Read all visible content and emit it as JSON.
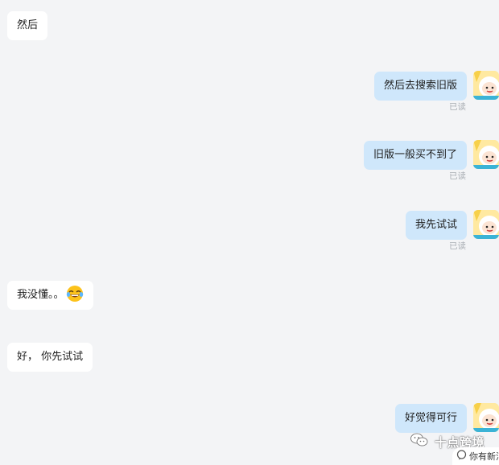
{
  "messages": [
    {
      "side": "left",
      "text": "然后"
    },
    {
      "side": "right",
      "text": "然后去搜索旧版",
      "status": "已读"
    },
    {
      "side": "right",
      "text": "旧版一般买不到了",
      "status": "已读"
    },
    {
      "side": "right",
      "text": "我先试试",
      "status": "已读"
    },
    {
      "side": "left",
      "text": "我没懂。。",
      "emoji": "joy-emoji"
    },
    {
      "side": "left",
      "text": "好， 你先试试"
    },
    {
      "side": "right",
      "text": "好觉得可行"
    }
  ],
  "watermark": {
    "text": "十点跨境",
    "icon": "wechat-icon"
  },
  "new_message_tip": {
    "text": "你有新消息",
    "icon": "chat-bubble-icon"
  },
  "colors": {
    "background": "#f3f4f6",
    "left_bubble": "#ffffff",
    "right_bubble": "#cfe7fb",
    "read_status": "#a8adb3"
  }
}
